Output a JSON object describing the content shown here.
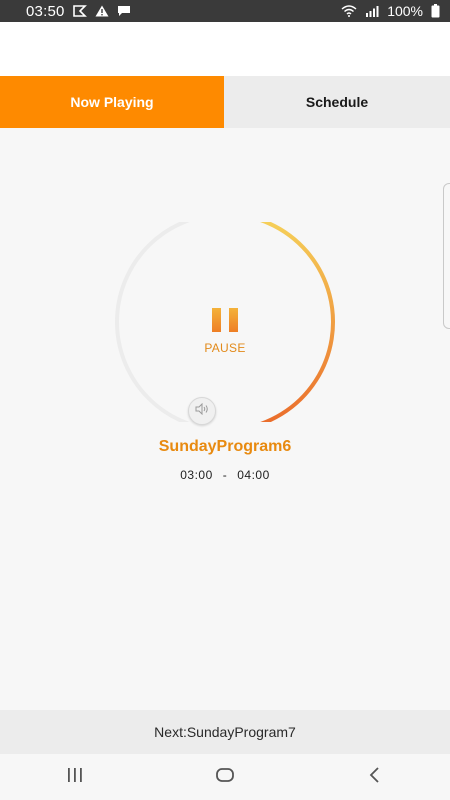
{
  "status_bar": {
    "time": "03:50",
    "battery": "100%",
    "icons": [
      "flag-icon",
      "warning-icon",
      "message-icon",
      "wifi-icon",
      "signal-icon",
      "battery-icon"
    ]
  },
  "tabs": [
    {
      "label": "Now Playing",
      "active": true
    },
    {
      "label": "Schedule",
      "active": false
    }
  ],
  "player": {
    "state_label": "PAUSE",
    "progress": 0.55,
    "program_title": "SundayProgram6",
    "start_time": "03:00",
    "separator": "-",
    "end_time": "04:00"
  },
  "next": {
    "text": "Next:SundayProgram7"
  },
  "nav": {
    "icons": [
      "recent-apps-icon",
      "home-icon",
      "back-icon"
    ]
  },
  "colors": {
    "accent": "#fe8a00",
    "ring_start": "#f6d35a",
    "ring_end": "#ea6a2a",
    "title": "#e88a10",
    "status_bar_bg": "#3a3a3a"
  }
}
